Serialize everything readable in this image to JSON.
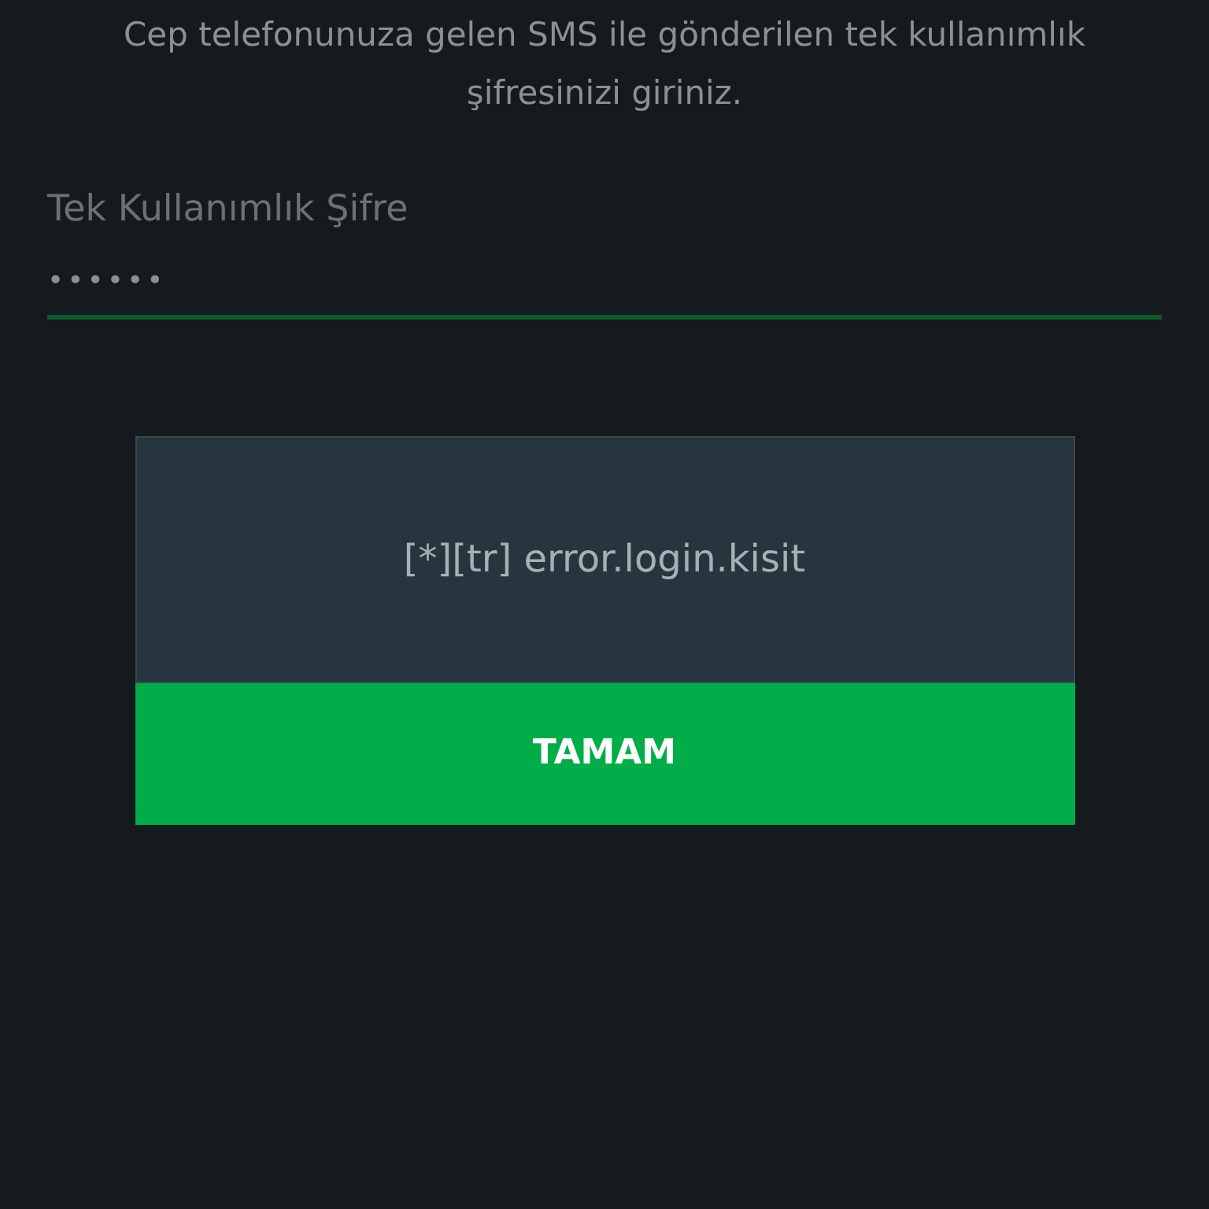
{
  "instructions": "Cep telefonunuza gelen SMS ile gönderilen tek kullanımlık şifresinizi giriniz.",
  "otp_field": {
    "label": "Tek Kullanımlık Şifre",
    "value": "••••••",
    "focused": true
  },
  "dialog": {
    "message": "[*][tr] error.login.kisit",
    "buttons": [
      "TAMAM"
    ]
  }
}
